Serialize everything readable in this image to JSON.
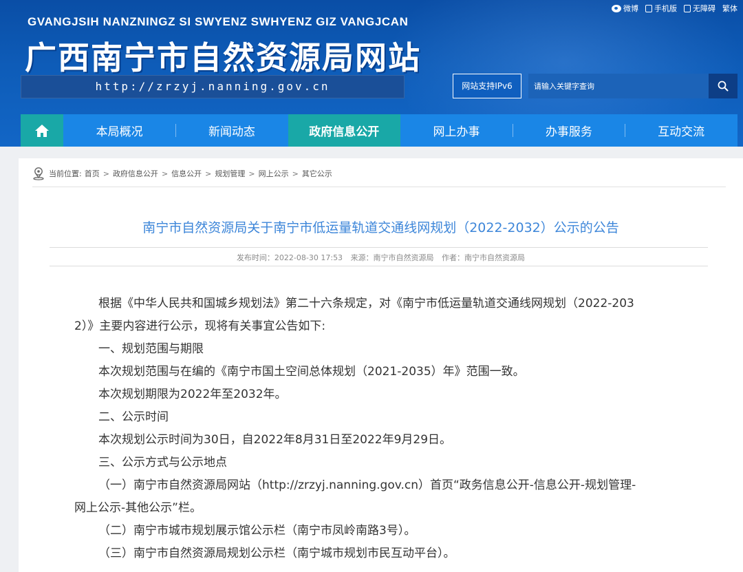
{
  "header": {
    "pinyin": "GVANGJSIH NANZNINGZ SI SWYENZ SWHYENZ GIZ VANGJCAN",
    "title": "广西南宁市自然资源局网站",
    "url": "http://zrzyj.nanning.gov.cn",
    "toplinks": [
      {
        "label": "微博",
        "icon": "weibo-icon"
      },
      {
        "label": "手机版",
        "icon": "mobile-icon"
      },
      {
        "label": "无障碍",
        "icon": "accessibility-icon"
      },
      {
        "label": "繁体",
        "icon": ""
      }
    ],
    "ipv6_label": "网站支持IPv6",
    "search_placeholder": "请输入关键字查询"
  },
  "nav": {
    "home_icon": "home-icon",
    "items": [
      "本局概况",
      "新闻动态",
      "政府信息公开",
      "网上办事",
      "办事服务",
      "互动交流"
    ],
    "active_index": 2
  },
  "breadcrumb": {
    "prefix": "当前位置:",
    "items": [
      "首页",
      "政府信息公开",
      "信息公开",
      "规划管理",
      "网上公示",
      "其它公示"
    ],
    "separator": ">"
  },
  "article": {
    "title": "南宁市自然资源局关于南宁市低运量轨道交通线网规划（2022-2032）公示的公告",
    "published": "发布时间：2022-08-30 17:53",
    "source": "来源：南宁市自然资源局",
    "author": "作者：南宁市自然资源局",
    "paragraphs": [
      "根据《中华人民共和国城乡规划法》第二十六条规定，对《南宁市低运量轨道交通线网规划（2022-203",
      "2）》主要内容进行公示，现将有关事宜公告如下:",
      "一、规划范围与期限",
      "本次规划范围与在编的《南宁市国土空间总体规划（2021-2035）年》范围一致。",
      "本次规划期限为2022年至2032年。",
      "二、公示时间",
      "本次规划公示时间为30日，自2022年8月31日至2022年9月29日。",
      "三、公示方式与公示地点",
      "（一）南宁市自然资源局网站（http://zrzyj.nanning.gov.cn）首页“政务信息公开-信息公开-规划管理-",
      "网上公示-其他公示”栏。",
      "（二）南宁市城市规划展示馆公示栏（南宁市凤岭南路3号）。",
      "（三）南宁市自然资源局规划公示栏（南宁城市规划市民互动平台）。"
    ]
  },
  "colors": {
    "header_blue": "#0e5cb8",
    "nav_blue": "#1a86e6",
    "nav_active_teal": "#19a8a7",
    "title_blue": "#3d86d9"
  }
}
